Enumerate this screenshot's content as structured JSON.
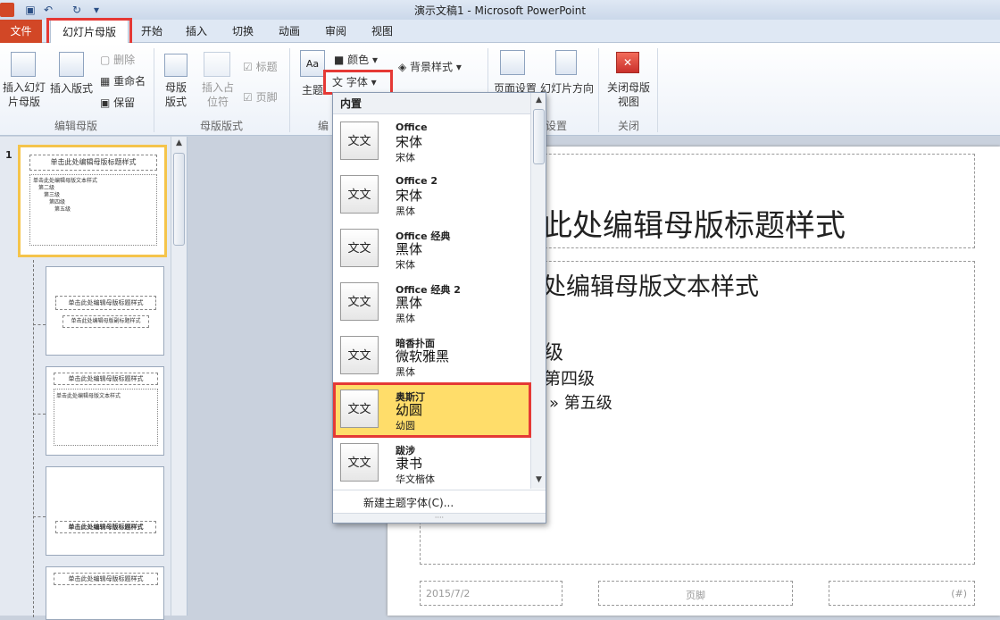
{
  "titlebar": {
    "title": "演示文稿1 - Microsoft PowerPoint",
    "app_icon": "P",
    "qa_icons": [
      "save-icon",
      "undo-icon",
      "redo-icon",
      "customize-icon"
    ]
  },
  "tabs": [
    {
      "label": "文件"
    },
    {
      "label": "幻灯片母版"
    },
    {
      "label": "开始"
    },
    {
      "label": "插入"
    },
    {
      "label": "切换"
    },
    {
      "label": "动画"
    },
    {
      "label": "审阅"
    },
    {
      "label": "视图"
    }
  ],
  "ribbon": {
    "insert_slide_master": "插入幻灯片母版",
    "insert_layout": "插入版式",
    "delete": "删除",
    "rename": "重命名",
    "preserve": "保留",
    "group_edit_master": "编辑母版",
    "master_layout": "母版版式",
    "insert_placeholder": "插入占位符",
    "title_check": "标题",
    "footer_check": "页脚",
    "group_master_layout": "母版版式",
    "themes": "主题",
    "colors": "颜色",
    "fonts": "字体",
    "group_edit_theme_short": "编",
    "background_styles": "背景样式",
    "page_setup": "页面设置",
    "slide_orientation": "幻灯片方向",
    "group_page_setup_tail": "设置",
    "close_master": "关闭母版视图",
    "group_close": "关闭",
    "theme_icon_text": "Aa",
    "font_icon_text": "文"
  },
  "fonts_menu": {
    "header": "内置",
    "swatch_text": "文文",
    "items": [
      {
        "name": "Office",
        "heading": "宋体",
        "body": "宋体"
      },
      {
        "name": "Office 2",
        "heading": "宋体",
        "body": "黑体"
      },
      {
        "name": "Office 经典",
        "heading": "黑体",
        "body": "宋体"
      },
      {
        "name": "Office 经典 2",
        "heading": "黑体",
        "body": "黑体"
      },
      {
        "name": "暗香扑面",
        "heading": "微软雅黑",
        "body": "黑体"
      },
      {
        "name": "奥斯汀",
        "heading": "幼圆",
        "body": "幼圆"
      },
      {
        "name": "跋涉",
        "heading": "隶书",
        "body": "华文楷体"
      }
    ],
    "footer": "新建主题字体(C)..."
  },
  "slide": {
    "title": "此处编辑母版标题样式",
    "body_level1": "处编辑母版文本样式",
    "level3": "级",
    "level4": "第四级",
    "level5": "» 第五级",
    "date": "2015/7/2",
    "footer": "页脚",
    "number": "(#)"
  },
  "thumbnails": {
    "slide_number": "1",
    "master_title": "单击此处编辑母版标题样式",
    "master_text": "单击此处编辑母版文本样式",
    "level2": "第二级",
    "level3": "第三级",
    "level4": "第四级",
    "level5": "第五级",
    "subtitle": "单击此处编辑母版副标题样式"
  }
}
